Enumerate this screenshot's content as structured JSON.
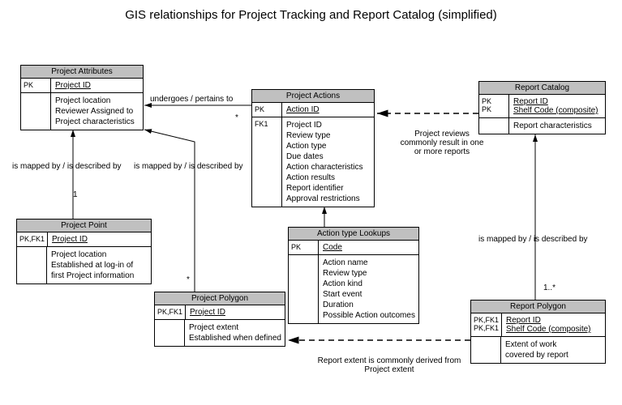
{
  "title": "GIS relationships for Project Tracking and Report Catalog (simplified)",
  "entities": {
    "projectAttributes": {
      "name": "Project Attributes",
      "pkLabel": "PK",
      "pkField": "Project ID",
      "attrs": [
        "Project location",
        "Reviewer Assigned to",
        "Project characteristics"
      ]
    },
    "projectActions": {
      "name": "Project Actions",
      "pkLabel": "PK",
      "pkField": "Action ID",
      "fkLabel": "FK1",
      "attrs": [
        "Project ID",
        "Review type",
        "Action type",
        "Due dates",
        "Action characteristics",
        "Action results",
        "Report identifier",
        "Approval restrictions"
      ]
    },
    "reportCatalog": {
      "name": "Report Catalog",
      "pkLabel1": "PK",
      "pkLabel2": "PK",
      "pkField1": "Report ID",
      "pkField2": "Shelf Code (composite)",
      "attrs": [
        "Report characteristics"
      ]
    },
    "projectPoint": {
      "name": "Project Point",
      "pkLabel": "PK,FK1",
      "pkField": "Project ID",
      "attrs": [
        "Project location",
        "Established at log-in of",
        "first Project information"
      ]
    },
    "projectPolygon": {
      "name": "Project Polygon",
      "pkLabel": "PK,FK1",
      "pkField": "Project ID",
      "attrs": [
        "Project extent",
        "Established when defined"
      ]
    },
    "actionTypeLookups": {
      "name": "Action type Lookups",
      "pkLabel": "PK",
      "pkField": "Code",
      "attrs": [
        "Action name",
        "Review type",
        "Action kind",
        "Start event",
        "Duration",
        "Possible Action outcomes"
      ]
    },
    "reportPolygon": {
      "name": "Report Polygon",
      "pkLabel1": "PK,FK1",
      "pkLabel2": "PK,FK1",
      "pkField1": "Report ID",
      "pkField2": "Shelf Code (composite)",
      "attrs": [
        "Extent of work",
        "covered by report"
      ]
    }
  },
  "relations": {
    "undergoes": "undergoes / pertains to",
    "mappedBy": "is mapped by / is described by",
    "reviewsResult": "Project reviews commonly result in one or more reports",
    "extentDerived": "Report extent is commonly derived from Project extent",
    "one": "1",
    "star": "*",
    "oneMany": "1..*"
  }
}
